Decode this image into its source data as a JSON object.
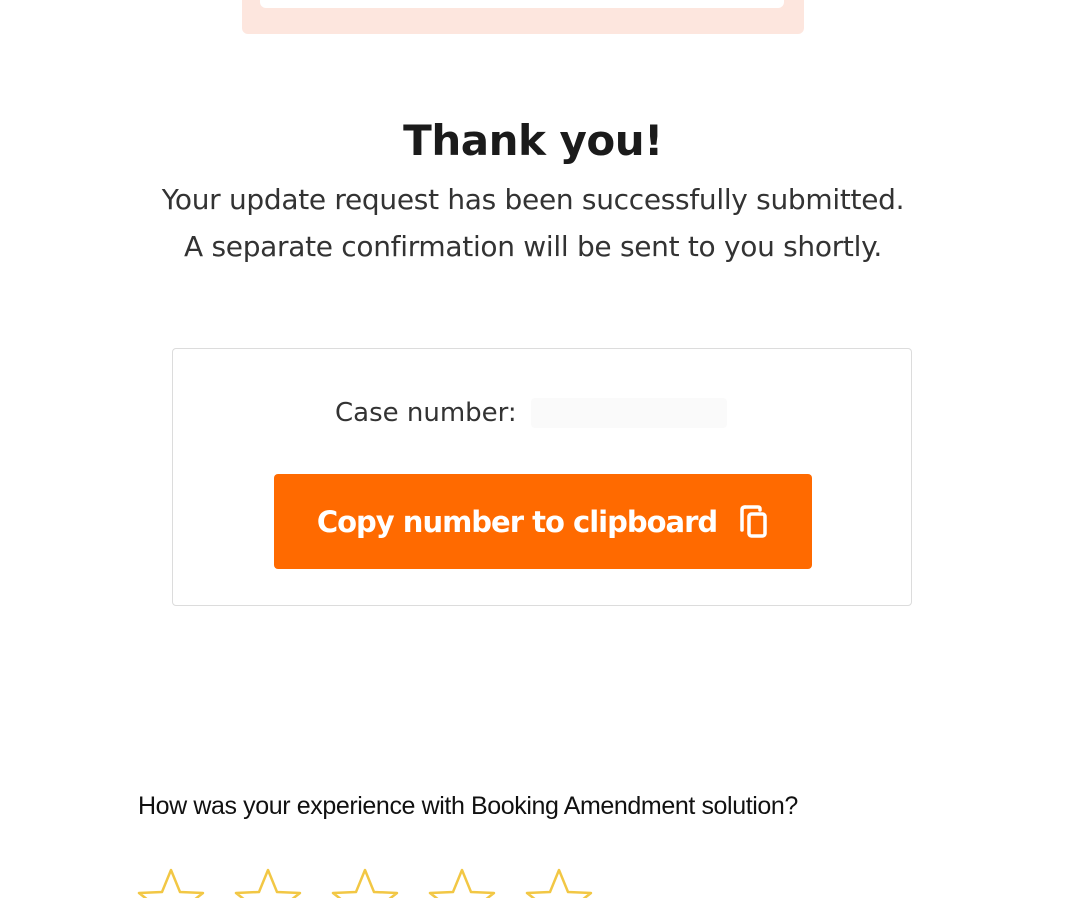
{
  "confirmation": {
    "title": "Thank you!",
    "message_line1": "Your update request has been successfully submitted.",
    "message_line2": "A separate confirmation will be sent to you shortly."
  },
  "case": {
    "label": "Case number:",
    "value": "",
    "copy_button_label": "Copy number to clipboard",
    "copy_icon": "copy-icon"
  },
  "feedback": {
    "question": "How was your experience with Booking Amendment solution?",
    "star_count": 5,
    "star_icon": "star-outline-icon"
  },
  "colors": {
    "accent": "#ff6a00",
    "banner": "#fde6de",
    "star": "#f2c744"
  }
}
